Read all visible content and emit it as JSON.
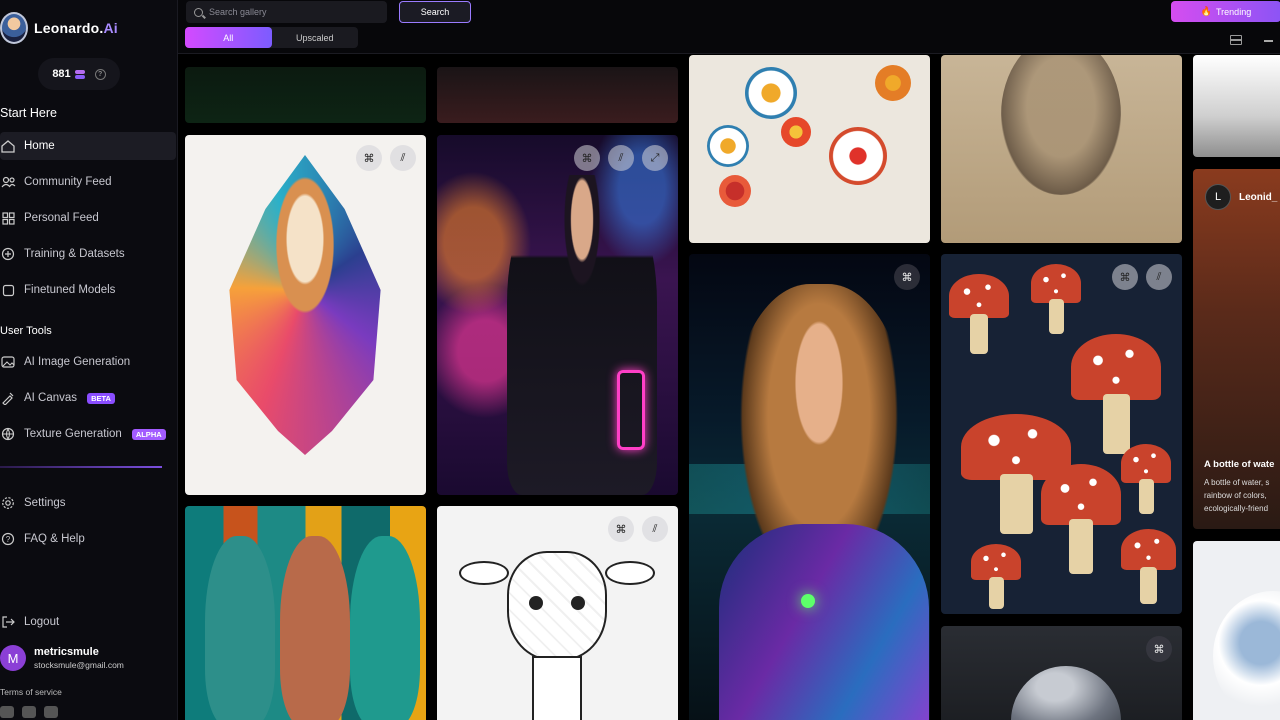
{
  "brand": {
    "name": "Leonardo.",
    "name_suffix": "Ai"
  },
  "credits": {
    "amount": "881"
  },
  "sidebar": {
    "start_here_title": "Start Here",
    "start_items": [
      {
        "label": "Home",
        "icon": "home-icon",
        "active": true
      },
      {
        "label": "Community Feed",
        "icon": "users-icon"
      },
      {
        "label": "Personal Feed",
        "icon": "grid-icon"
      },
      {
        "label": "Training & Datasets",
        "icon": "training-icon"
      },
      {
        "label": "Finetuned Models",
        "icon": "cube-icon"
      }
    ],
    "user_tools_title": "User Tools",
    "tool_items": [
      {
        "label": "AI Image Generation",
        "icon": "image-gen-icon",
        "badge": ""
      },
      {
        "label": "AI Canvas",
        "icon": "canvas-icon",
        "badge": "BETA"
      },
      {
        "label": "Texture Generation",
        "icon": "texture-icon",
        "badge": "ALPHA"
      }
    ],
    "bottom_items": [
      {
        "label": "Settings",
        "icon": "gear-icon"
      },
      {
        "label": "FAQ & Help",
        "icon": "help-icon"
      }
    ],
    "logout_label": "Logout",
    "user": {
      "initial": "M",
      "name": "metricsmule",
      "email": "stocksmule@gmail.com"
    },
    "terms_label": "Terms of service"
  },
  "header": {
    "search_placeholder": "Search gallery",
    "search_button": "Search",
    "tabs": [
      {
        "label": "All",
        "active": true
      },
      {
        "label": "Upscaled",
        "active": false
      }
    ],
    "trending_label": "Trending"
  },
  "gallery": {
    "featured": {
      "author_initial": "L",
      "author_name": "Leonid_",
      "title": "A bottle of wate",
      "description_lines": [
        "A bottle of water, s",
        "rainbow of colors,",
        "ecologically-friend"
      ]
    }
  },
  "colors": {
    "accent": "#9a7bff",
    "accent_gradient_start": "#d44aff",
    "accent_gradient_end": "#7c5cff",
    "badge": "#8a4dff"
  }
}
